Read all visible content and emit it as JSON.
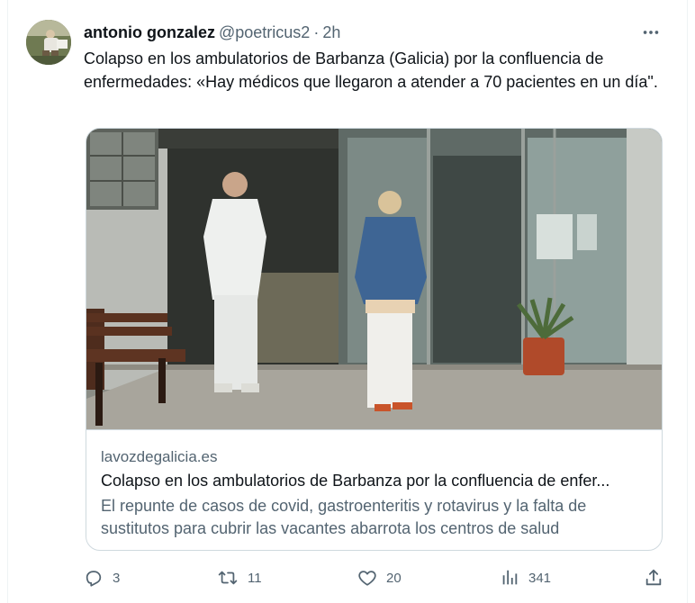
{
  "tweet": {
    "display_name": "antonio gonzalez",
    "handle": "@poetricus2",
    "separator": "·",
    "time": "2h",
    "text": "Colapso en los ambulatorios de Barbanza (Galicia) por la confluencia de enfermedades: «Hay médicos que llegaron a atender a 70 pacientes en un día\"."
  },
  "card": {
    "domain": "lavozdegalicia.es",
    "title": "Colapso en los ambulatorios de Barbanza por la confluencia de enfer...",
    "description": "El repunte de casos de covid, gastroenteritis y rotavirus y la falta de sustitutos para cubrir las vacantes abarrota los centros de salud"
  },
  "actions": {
    "replies": "3",
    "retweets": "11",
    "likes": "20",
    "views": "341"
  },
  "icons": {
    "more": "more-dots-icon",
    "reply": "reply-icon",
    "retweet": "retweet-icon",
    "like": "heart-icon",
    "views": "views-chart-icon",
    "share": "share-icon"
  },
  "colors": {
    "text_primary": "#0f1419",
    "text_secondary": "#536471",
    "border": "#cfd9de"
  }
}
